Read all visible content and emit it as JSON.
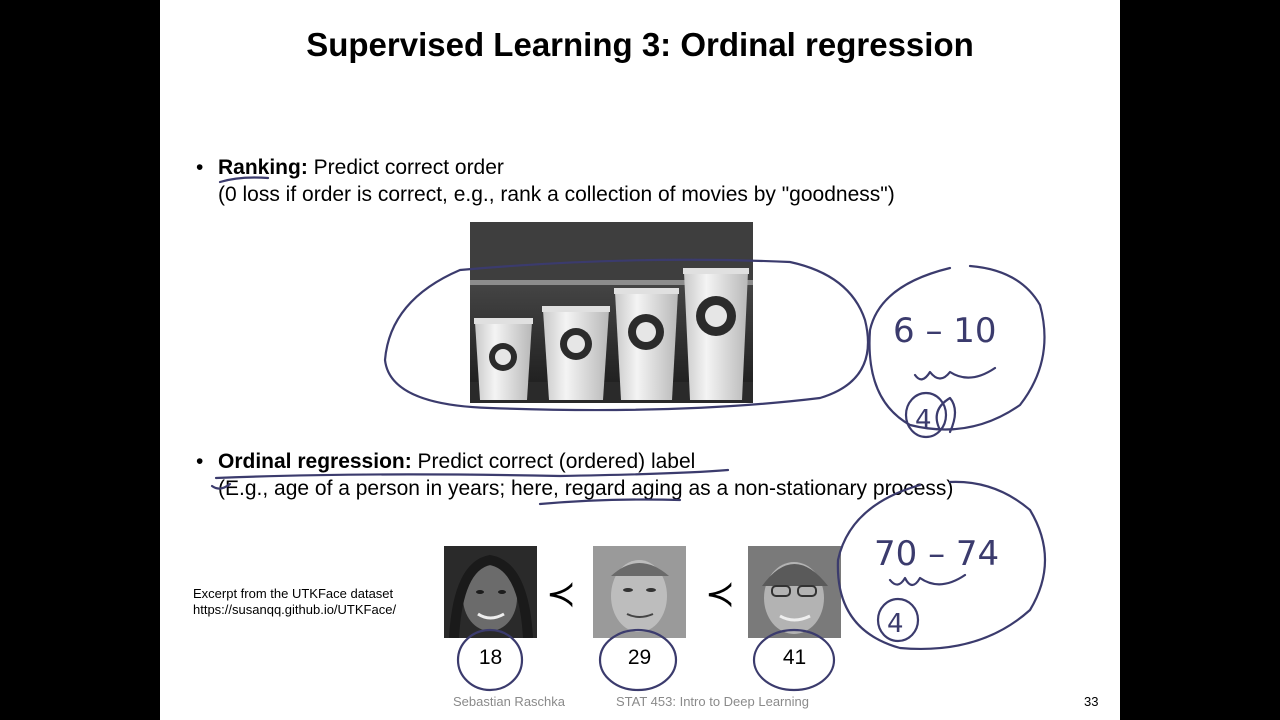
{
  "slide": {
    "title": "Supervised Learning 3: Ordinal regression",
    "bullets": [
      {
        "bold": "Ranking:",
        "text": " Predict correct order",
        "subtext": "(0 loss if order is correct, e.g., rank a collection of movies by \"goodness\")"
      },
      {
        "bold": "Ordinal regression:",
        "text": " Predict correct (ordered) label",
        "subtext": "(E.g., age of a person in years; here, regard aging as a non-stationary process)"
      }
    ],
    "faces": {
      "ages": [
        "18",
        "29",
        "41"
      ],
      "precedes_symbol": "≺"
    },
    "caption": {
      "line1": "Excerpt from the UTKFace dataset",
      "line2": "https://susanqq.github.io/UTKFace/"
    },
    "annotations": {
      "range1": "6 – 10",
      "digit1": "4",
      "range2": "70 – 74",
      "digit2": "4"
    },
    "footer": {
      "author": "Sebastian Raschka",
      "course": "STAT 453: Intro to Deep Learning",
      "page": "33"
    },
    "colors": {
      "ink": "#3b3b6d",
      "footer_text": "#8a8a8a"
    }
  }
}
